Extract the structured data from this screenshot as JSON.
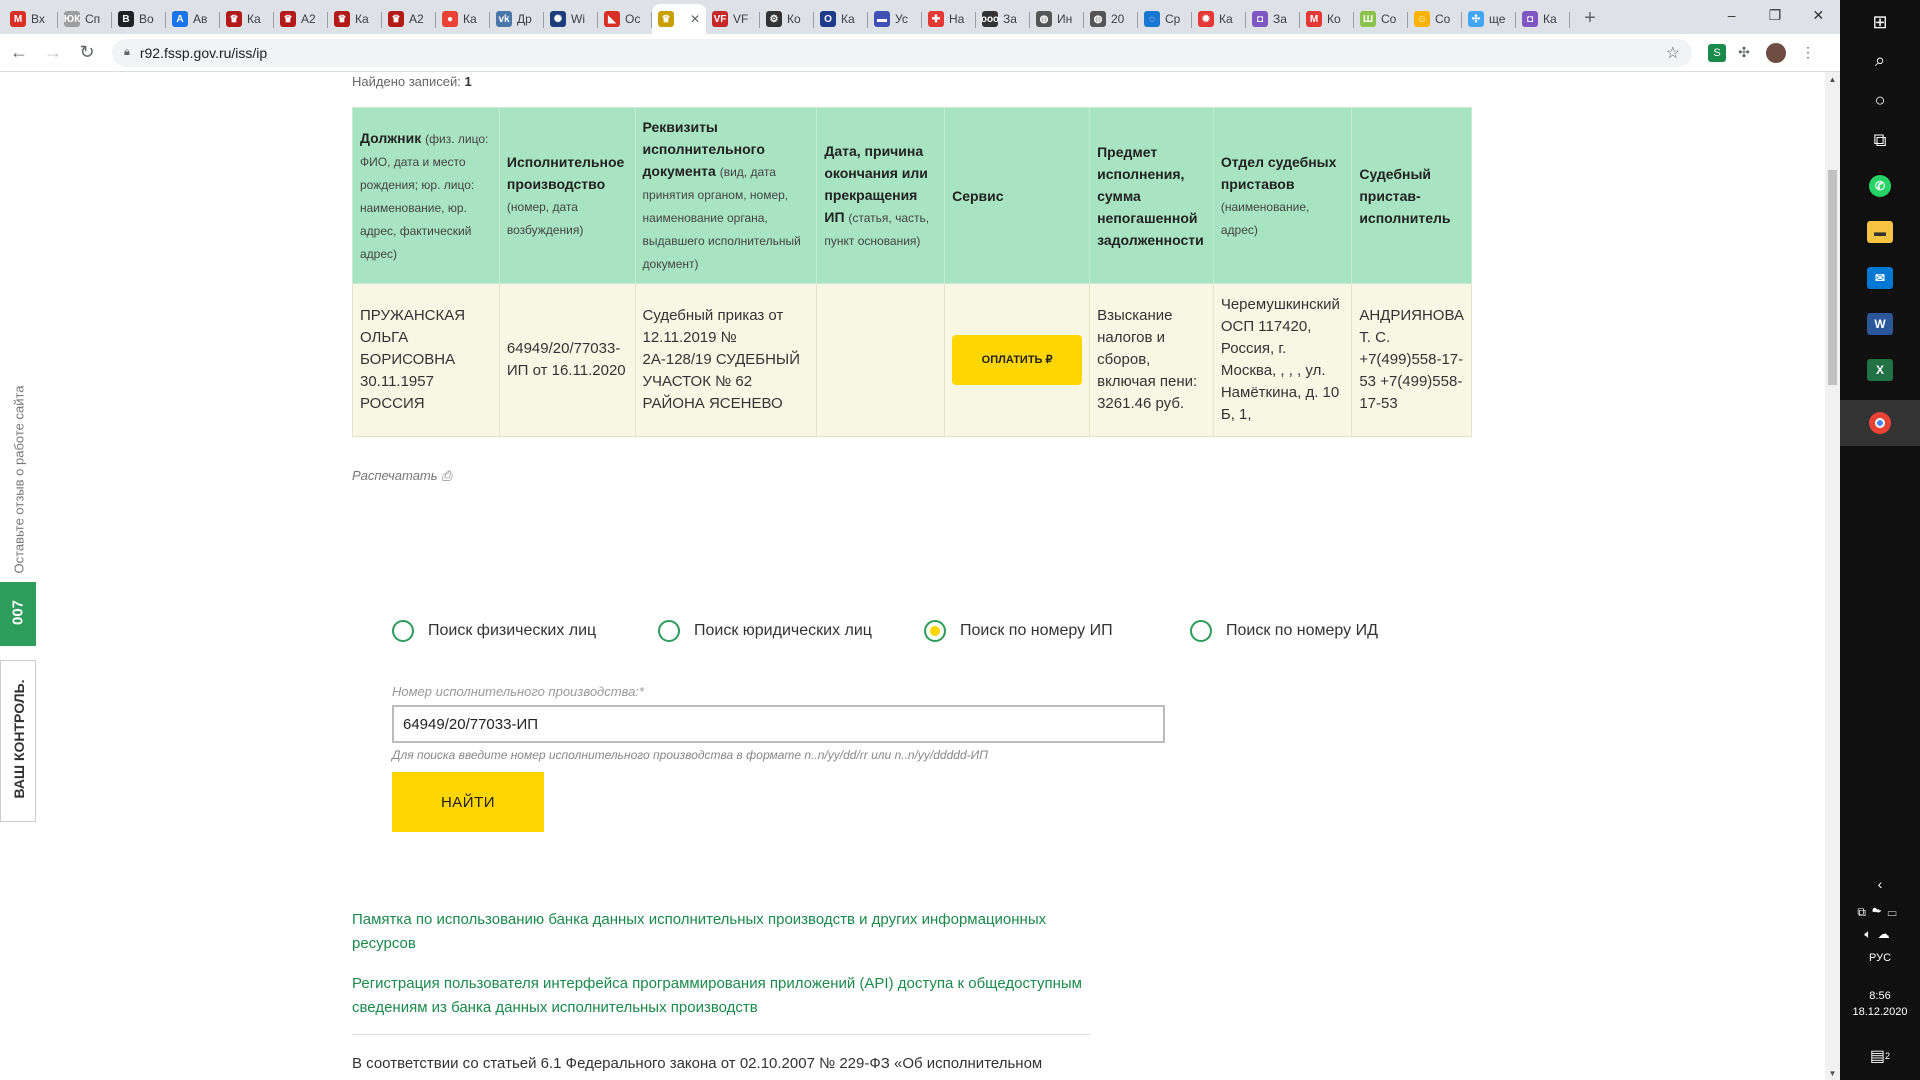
{
  "browser": {
    "tabs": [
      {
        "label": "Вх",
        "color": "#d93025",
        "glyph": "M"
      },
      {
        "label": "Сп",
        "color": "#9e9e9e",
        "glyph": "ЮК"
      },
      {
        "label": "Во",
        "color": "#202124",
        "glyph": "В"
      },
      {
        "label": "Ав",
        "color": "#1a73e8",
        "glyph": "A"
      },
      {
        "label": "Ка",
        "color": "#b31b1b",
        "glyph": "♛"
      },
      {
        "label": "А2",
        "color": "#b31b1b",
        "glyph": "♛"
      },
      {
        "label": "Ка",
        "color": "#b31b1b",
        "glyph": "♛"
      },
      {
        "label": "А2",
        "color": "#b31b1b",
        "glyph": "♛"
      },
      {
        "label": "Ка",
        "color": "#ea4335",
        "glyph": "●"
      },
      {
        "label": "Др",
        "color": "#4a76a8",
        "glyph": "vk"
      },
      {
        "label": "Wi",
        "color": "#1f3d7a",
        "glyph": "✺"
      },
      {
        "label": "Ос",
        "color": "#d93025",
        "glyph": "◣"
      },
      {
        "label": "",
        "color": "#caa000",
        "glyph": "♛",
        "active": true
      },
      {
        "label": "VF",
        "color": "#c62828",
        "glyph": "VF"
      },
      {
        "label": "Ко",
        "color": "#333333",
        "glyph": "⚙"
      },
      {
        "label": "Ка",
        "color": "#1e3a8a",
        "glyph": "O"
      },
      {
        "label": "Ус",
        "color": "#3f51b5",
        "glyph": "▬"
      },
      {
        "label": "На",
        "color": "#e53935",
        "glyph": "✚"
      },
      {
        "label": "За",
        "color": "#333333",
        "glyph": "ooo"
      },
      {
        "label": "Ин",
        "color": "#555555",
        "glyph": "◍"
      },
      {
        "label": "20",
        "color": "#555555",
        "glyph": "◍"
      },
      {
        "label": "Ср",
        "color": "#1976d2",
        "glyph": "◌"
      },
      {
        "label": "Ка",
        "color": "#e53935",
        "glyph": "✹"
      },
      {
        "label": "За",
        "color": "#7e57c2",
        "glyph": "◘"
      },
      {
        "label": "Ко",
        "color": "#e53935",
        "glyph": "M"
      },
      {
        "label": "Со",
        "color": "#8bc34a",
        "glyph": "Ш"
      },
      {
        "label": "Со",
        "color": "#ffb300",
        "glyph": "☺"
      },
      {
        "label": "ще",
        "color": "#42a5f5",
        "glyph": "✣"
      },
      {
        "label": "Ка",
        "color": "#7e57c2",
        "glyph": "◘"
      }
    ],
    "url": "r92.fssp.gov.ru/iss/ip",
    "window_controls": [
      "–",
      "❐",
      "✕"
    ]
  },
  "side_widget": {
    "feedback_label": "Оставьте отзыв о работе сайта",
    "tab_007": "007",
    "tab_control": "ВАШ КОНТРОЛЬ."
  },
  "results": {
    "found_label": "Найдено записей:",
    "found_count": "1",
    "headers": [
      {
        "title": "Должник",
        "note": "(физ. лицо: ФИО, дата и место рождения; юр. лицо: наименование, юр. адрес, фактический адрес)"
      },
      {
        "title": "Исполнительное производство",
        "note": "(номер, дата возбуждения)"
      },
      {
        "title": "Реквизиты исполнительного документа",
        "note": "(вид, дата принятия органом, номер, наименование органа, выдавшего исполнительный документ)"
      },
      {
        "title": "Дата, причина окончания или прекращения ИП",
        "note": "(статья, часть, пункт основания)"
      },
      {
        "title": "Сервис",
        "note": ""
      },
      {
        "title": "Предмет исполнения, сумма непогашенной задолженности",
        "note": ""
      },
      {
        "title": "Отдел судебных приставов",
        "note": "(наименование, адрес)"
      },
      {
        "title": "Судебный пристав-исполнитель",
        "note": ""
      }
    ],
    "row": {
      "debtor": "ПРУЖАНСКАЯ ОЛЬГА БОРИСОВНА 30.11.1957 РОССИЯ",
      "proceeding": "64949/20/77033-ИП от 16.11.2020",
      "document": "Судебный приказ от 12.11.2019 № 2А-128/19 СУДЕБНЫЙ УЧАСТОК № 62 РАЙОНА ЯСЕНЕВО",
      "end_reason": "",
      "pay_button": "ОПЛАТИТЬ ₽",
      "subject": "Взыскание налогов и сборов, включая пени: 3261.46 руб.",
      "department": "Черемушкинский ОСП 117420, Россия, г. Москва, , , , ул. Намёткина, д. 10 Б, 1,",
      "bailiff": "АНДРИЯНОВА Т. С. +7(499)558-17-53 +7(499)558-17-53"
    },
    "print_label": "Распечатать"
  },
  "search": {
    "options": [
      {
        "label": "Поиск физических лиц",
        "selected": false
      },
      {
        "label": "Поиск юридических лиц",
        "selected": false
      },
      {
        "label": "Поиск по номеру ИП",
        "selected": true
      },
      {
        "label": "Поиск по номеру ИД",
        "selected": false
      }
    ],
    "field_label": "Номер исполнительного производства:*",
    "field_value": "64949/20/77033-ИП",
    "hint": "Для поиска введите номер исполнительного производства в формате n..n/yy/dd/rr или n..n/yy/ddddd-ИП",
    "find_button": "НАЙТИ"
  },
  "links": [
    "Памятка по использованию банка данных исполнительных производств и других информационных ресурсов",
    "Регистрация пользователя интерфейса программирования приложений (API) доступа к общедоступным сведениям из банка данных исполнительных производств"
  ],
  "law_text": "В соответствии со статьей 6.1 Федерального закона от 02.10.2007 № 229-ФЗ «Об исполнительном",
  "taskbar": {
    "language": "РУС",
    "time": "8:56",
    "date": "18.12.2020",
    "notifications": "2"
  },
  "colors": {
    "accent_green": "#2e9c5a",
    "header_green": "#a9e4c2",
    "row_bg": "#f8f7e4",
    "button_yellow": "#ffd600",
    "link_green": "#1b8a4b"
  }
}
